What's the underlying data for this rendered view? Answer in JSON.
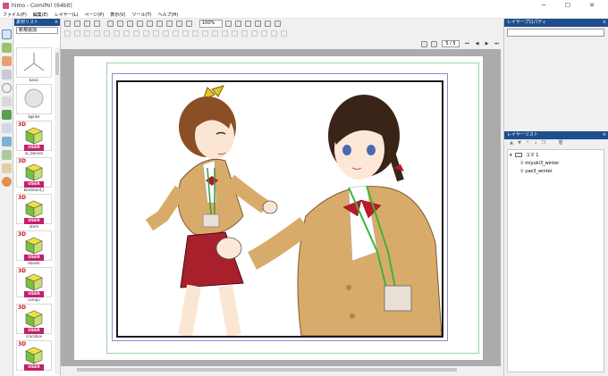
{
  "window": {
    "title": "himo - ComiPo! (64bit)",
    "minimize": "─",
    "maximize": "☐",
    "close": "✕"
  },
  "menu": [
    "ファイル(F)",
    "編集(E)",
    "レイヤー(L)",
    "ページ(P)",
    "表示(V)",
    "ツール(T)",
    "ヘルプ(H)"
  ],
  "toolbar": {
    "zoom_value": "100%"
  },
  "page_nav": {
    "page_value": "5 / 5",
    "first": "⏮",
    "prev": "◀",
    "next": "▶",
    "last": "⏭"
  },
  "material_panel": {
    "title": "素材リスト",
    "close": "×",
    "category": "新規追加",
    "items": [
      {
        "label": "basic",
        "kind": "axis"
      },
      {
        "label": "bgLike",
        "kind": "tree"
      },
      {
        "label": "ac_banner",
        "kind": "user3d"
      },
      {
        "label": "blackbord_l",
        "kind": "user3d"
      },
      {
        "label": "atem",
        "kind": "user3d"
      },
      {
        "label": "ebookr",
        "kind": "user3d"
      },
      {
        "label": "compu",
        "kind": "user3d"
      },
      {
        "label": "crackbox",
        "kind": "user3d"
      },
      {
        "label": "",
        "kind": "user3d"
      }
    ],
    "badge_3d": "3D",
    "badge_user": "USER"
  },
  "layer_properties": {
    "title": "レイヤープロパティ",
    "close": "×"
  },
  "layer_list": {
    "title": "レイヤーリスト",
    "close": "×",
    "group_label": "コマ 1",
    "layers": [
      "miyuki3_winter",
      "yae3_winter"
    ]
  },
  "colors": {
    "panel_header": "#1e4e8c",
    "user_badge": "#c41e6c",
    "badge_3d": "#cc1b1b",
    "canvas_bg": "#ababab"
  }
}
